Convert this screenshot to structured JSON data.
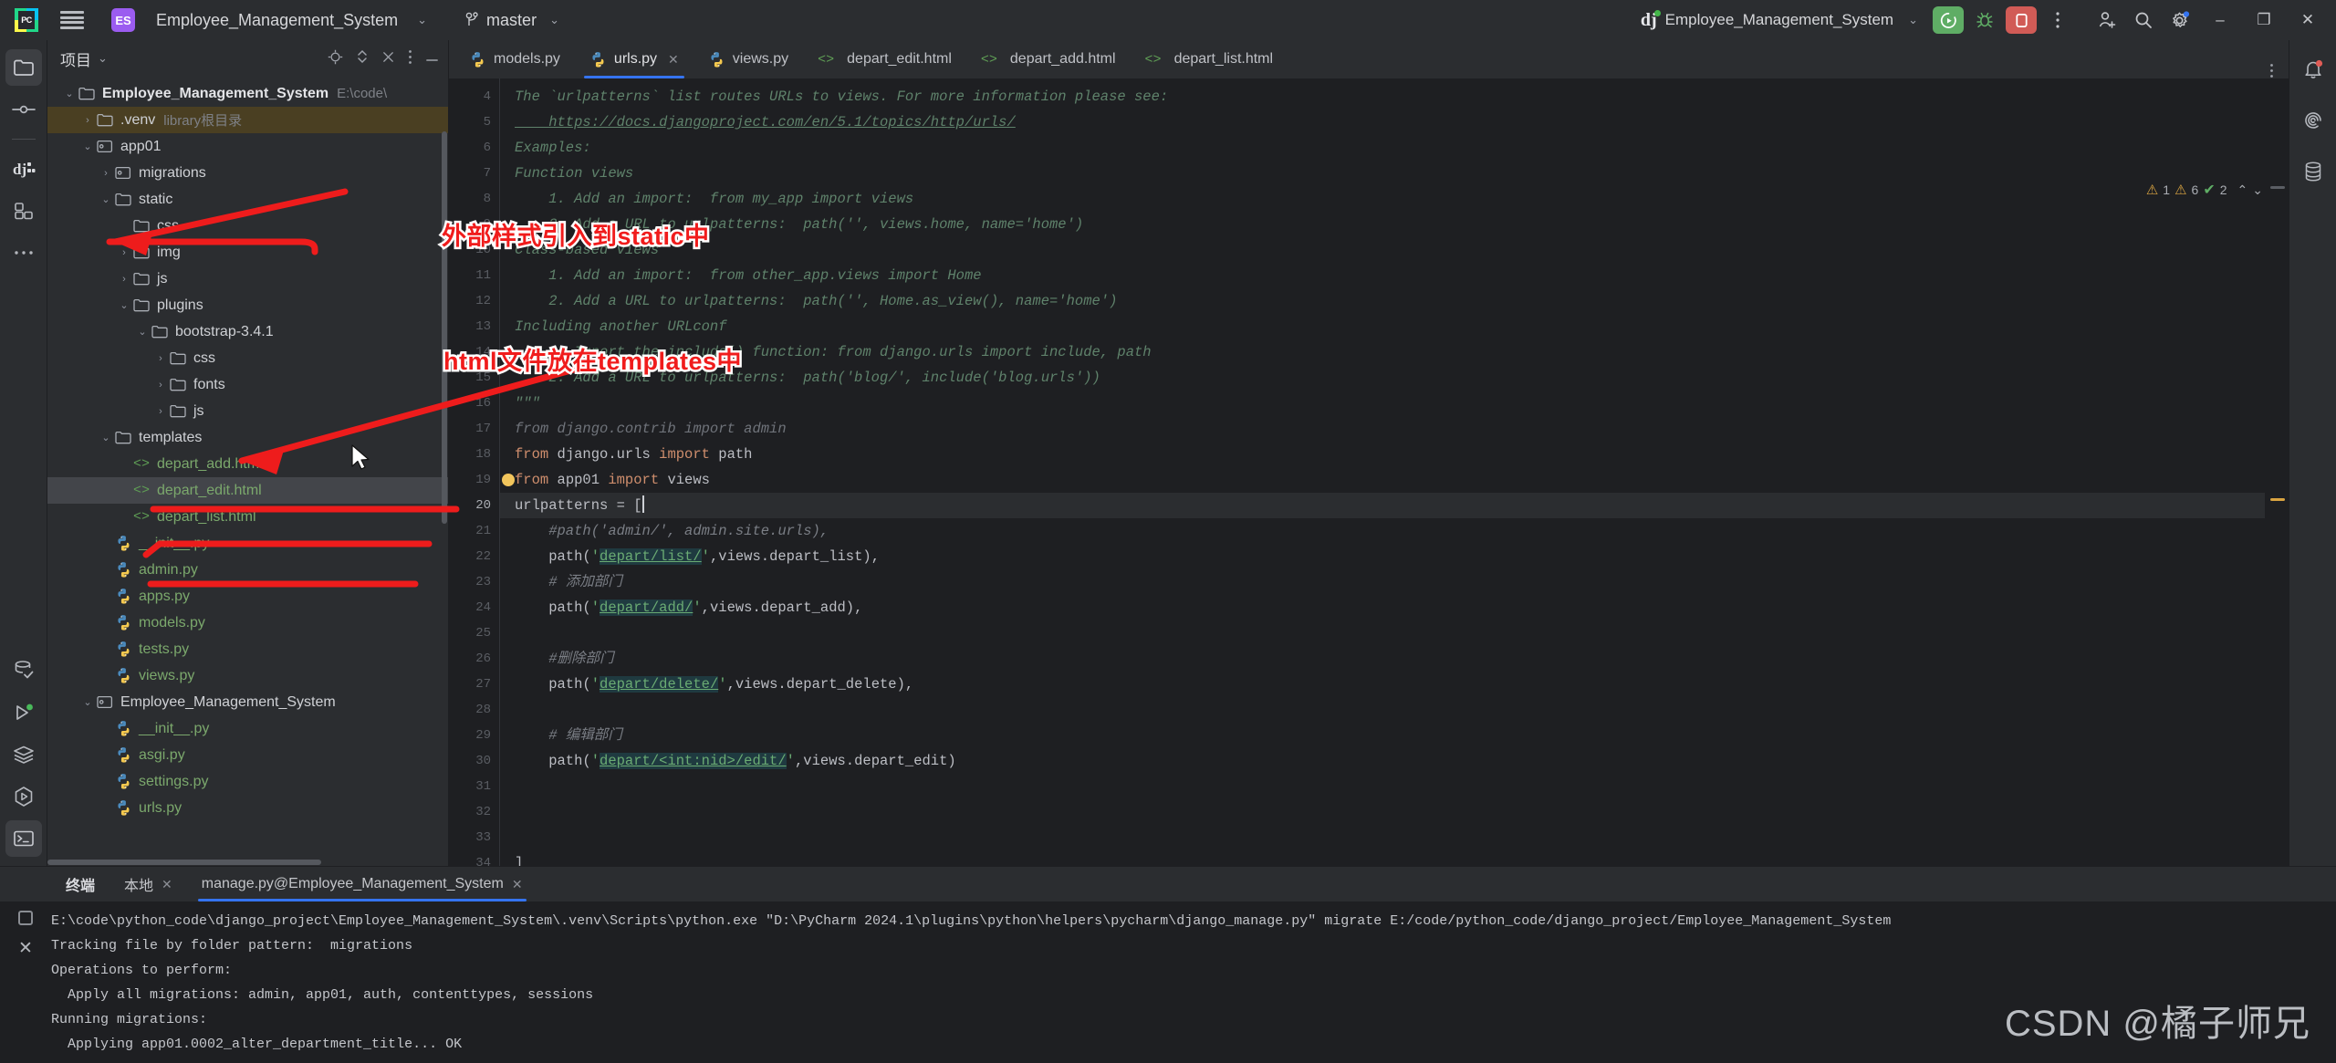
{
  "titlebar": {
    "menu_icon": "hamburger-icon",
    "project_badge": "ES",
    "project_name": "Employee_Management_System",
    "branch": "master",
    "run_config": "Employee_Management_System",
    "more_icon": "more-vertical-icon",
    "buttons": {
      "run": "run-icon",
      "debug": "debug-icon",
      "stop": "stop-icon",
      "account": "add-user-icon",
      "search": "search-icon",
      "settings": "settings-icon",
      "minimize": "–",
      "maximize": "❐",
      "close": "✕"
    }
  },
  "left_rail": {
    "items": [
      "project-icon",
      "commit-icon",
      "django-icon",
      "structure-icon",
      "more-icon"
    ],
    "bottom_items": [
      "database-check-icon",
      "run-icon",
      "services-icon",
      "plugins-icon",
      "terminal-icon"
    ]
  },
  "right_rail": {
    "items": [
      "notifications-icon",
      "ai-assistant-icon",
      "database-icon"
    ]
  },
  "project_panel": {
    "title": "项目",
    "head_icons": [
      "locate-icon",
      "expand-collapse-icon",
      "close-icon",
      "options-icon",
      "hide-icon"
    ],
    "tree": [
      {
        "depth": 0,
        "arrow": "v",
        "icon": "folder",
        "label": "Employee_Management_System",
        "sub": "E:\\code\\",
        "bold": true,
        "state": "normal"
      },
      {
        "depth": 1,
        "arrow": ">",
        "icon": "folder",
        "label": ".venv",
        "sub": "library根目录",
        "bold": false,
        "state": "venv"
      },
      {
        "depth": 1,
        "arrow": "v",
        "icon": "module",
        "label": "app01",
        "sub": "",
        "bold": false,
        "state": "normal"
      },
      {
        "depth": 2,
        "arrow": ">",
        "icon": "module",
        "label": "migrations",
        "sub": "",
        "bold": false,
        "state": "normal"
      },
      {
        "depth": 2,
        "arrow": "v",
        "icon": "folder",
        "label": "static",
        "sub": "",
        "bold": false,
        "state": "normal"
      },
      {
        "depth": 3,
        "arrow": "",
        "icon": "folder",
        "label": "css",
        "sub": "",
        "bold": false,
        "state": "normal"
      },
      {
        "depth": 3,
        "arrow": ">",
        "icon": "folder",
        "label": "img",
        "sub": "",
        "bold": false,
        "state": "normal"
      },
      {
        "depth": 3,
        "arrow": ">",
        "icon": "folder",
        "label": "js",
        "sub": "",
        "bold": false,
        "state": "normal"
      },
      {
        "depth": 3,
        "arrow": "v",
        "icon": "folder",
        "label": "plugins",
        "sub": "",
        "bold": false,
        "state": "normal"
      },
      {
        "depth": 4,
        "arrow": "v",
        "icon": "folder",
        "label": "bootstrap-3.4.1",
        "sub": "",
        "bold": false,
        "state": "normal"
      },
      {
        "depth": 5,
        "arrow": ">",
        "icon": "folder",
        "label": "css",
        "sub": "",
        "bold": false,
        "state": "normal"
      },
      {
        "depth": 5,
        "arrow": ">",
        "icon": "folder",
        "label": "fonts",
        "sub": "",
        "bold": false,
        "state": "normal"
      },
      {
        "depth": 5,
        "arrow": ">",
        "icon": "folder",
        "label": "js",
        "sub": "",
        "bold": false,
        "state": "normal"
      },
      {
        "depth": 2,
        "arrow": "v",
        "icon": "folder",
        "label": "templates",
        "sub": "",
        "bold": false,
        "state": "normal"
      },
      {
        "depth": 3,
        "arrow": "",
        "icon": "html",
        "label": "depart_add.html",
        "sub": "",
        "bold": false,
        "state": "normal"
      },
      {
        "depth": 3,
        "arrow": "",
        "icon": "html",
        "label": "depart_edit.html",
        "sub": "",
        "bold": false,
        "state": "selected"
      },
      {
        "depth": 3,
        "arrow": "",
        "icon": "html",
        "label": "depart_list.html",
        "sub": "",
        "bold": false,
        "state": "normal"
      },
      {
        "depth": 2,
        "arrow": "",
        "icon": "py",
        "label": "__init__.py",
        "sub": "",
        "bold": false,
        "state": "normal"
      },
      {
        "depth": 2,
        "arrow": "",
        "icon": "py",
        "label": "admin.py",
        "sub": "",
        "bold": false,
        "state": "normal"
      },
      {
        "depth": 2,
        "arrow": "",
        "icon": "py",
        "label": "apps.py",
        "sub": "",
        "bold": false,
        "state": "normal"
      },
      {
        "depth": 2,
        "arrow": "",
        "icon": "py",
        "label": "models.py",
        "sub": "",
        "bold": false,
        "state": "normal"
      },
      {
        "depth": 2,
        "arrow": "",
        "icon": "py",
        "label": "tests.py",
        "sub": "",
        "bold": false,
        "state": "normal"
      },
      {
        "depth": 2,
        "arrow": "",
        "icon": "py",
        "label": "views.py",
        "sub": "",
        "bold": false,
        "state": "normal"
      },
      {
        "depth": 1,
        "arrow": "v",
        "icon": "module",
        "label": "Employee_Management_System",
        "sub": "",
        "bold": false,
        "state": "normal"
      },
      {
        "depth": 2,
        "arrow": "",
        "icon": "py",
        "label": "__init__.py",
        "sub": "",
        "bold": false,
        "state": "normal"
      },
      {
        "depth": 2,
        "arrow": "",
        "icon": "py",
        "label": "asgi.py",
        "sub": "",
        "bold": false,
        "state": "normal"
      },
      {
        "depth": 2,
        "arrow": "",
        "icon": "py",
        "label": "settings.py",
        "sub": "",
        "bold": false,
        "state": "normal"
      },
      {
        "depth": 2,
        "arrow": "",
        "icon": "py",
        "label": "urls.py",
        "sub": "",
        "bold": false,
        "state": "normal"
      }
    ]
  },
  "editor": {
    "tabs": [
      {
        "label": "models.py",
        "icon": "python-icon",
        "active": false,
        "closable": false
      },
      {
        "label": "urls.py",
        "icon": "python-icon",
        "active": true,
        "closable": true
      },
      {
        "label": "views.py",
        "icon": "python-icon",
        "active": false,
        "closable": false
      },
      {
        "label": "depart_edit.html",
        "icon": "html-icon",
        "active": false,
        "closable": false
      },
      {
        "label": "depart_add.html",
        "icon": "html-icon",
        "active": false,
        "closable": false
      },
      {
        "label": "depart_list.html",
        "icon": "html-icon",
        "active": false,
        "closable": false
      }
    ],
    "inspection": {
      "warnings": "1",
      "weak_warnings": "6",
      "typos": "2",
      "up": "⌃",
      "down": "⌄"
    },
    "first_line_number": 4,
    "lines": [
      {
        "n": 4,
        "segs": [
          {
            "t": "The `urlpatterns` list routes URLs to views. For more information please see:",
            "c": "doc",
            "indent": 0
          }
        ]
      },
      {
        "n": 5,
        "segs": [
          {
            "t": "https://docs.djangoproject.com/en/5.1/topics/http/urls/",
            "c": "lnk",
            "indent": 4
          }
        ]
      },
      {
        "n": 6,
        "segs": [
          {
            "t": "Examples:",
            "c": "doc",
            "indent": 0
          }
        ]
      },
      {
        "n": 7,
        "segs": [
          {
            "t": "Function views",
            "c": "doc",
            "indent": 0
          }
        ]
      },
      {
        "n": 8,
        "segs": [
          {
            "t": "1. Add an import:  from my_app import views",
            "c": "doc",
            "indent": 4
          }
        ]
      },
      {
        "n": 9,
        "segs": [
          {
            "t": "2. Add a URL to urlpatterns:  path('', views.home, name='home')",
            "c": "doc",
            "indent": 4
          }
        ]
      },
      {
        "n": 10,
        "segs": [
          {
            "t": "Class-based views",
            "c": "doc",
            "indent": 0
          }
        ]
      },
      {
        "n": 11,
        "segs": [
          {
            "t": "1. Add an import:  from other_app.views import Home",
            "c": "doc",
            "indent": 4
          }
        ]
      },
      {
        "n": 12,
        "segs": [
          {
            "t": "2. Add a URL to urlpatterns:  path('', Home.as_view(), name='home')",
            "c": "doc",
            "indent": 4
          }
        ]
      },
      {
        "n": 13,
        "segs": [
          {
            "t": "Including another URLconf",
            "c": "doc",
            "indent": 0
          }
        ]
      },
      {
        "n": 14,
        "segs": [
          {
            "t": "1. Import the include() function: from django.urls import include, path",
            "c": "doc",
            "indent": 4
          }
        ]
      },
      {
        "n": 15,
        "segs": [
          {
            "t": "2. Add a URL to urlpatterns:  path('blog/', include('blog.urls'))",
            "c": "doc",
            "indent": 4
          }
        ]
      },
      {
        "n": 16,
        "segs": [
          {
            "t": "\"\"\"",
            "c": "doc",
            "indent": 0
          }
        ]
      },
      {
        "n": 17,
        "segs": [
          {
            "t": "from django.contrib import admin",
            "c": "gray",
            "indent": 0
          }
        ]
      },
      {
        "n": 18,
        "segs": [
          {
            "t": "from ",
            "c": "kw",
            "indent": 0
          },
          {
            "t": "django.urls ",
            "c": "id"
          },
          {
            "t": "import ",
            "c": "kw"
          },
          {
            "t": "path",
            "c": "id"
          }
        ]
      },
      {
        "n": 19,
        "segs": [
          {
            "t": "from ",
            "c": "kw",
            "indent": 0
          },
          {
            "t": "app01 ",
            "c": "id"
          },
          {
            "t": "import ",
            "c": "kw"
          },
          {
            "t": "views",
            "c": "id"
          }
        ]
      },
      {
        "n": 20,
        "segs": [
          {
            "t": "urlpatterns = [",
            "c": "id",
            "indent": 0
          }
        ],
        "current": true,
        "cursor": true
      },
      {
        "n": 21,
        "segs": [
          {
            "t": "#path('admin/', admin.site.urls),",
            "c": "cmt",
            "indent": 4
          }
        ]
      },
      {
        "n": 22,
        "segs": [
          {
            "t": "path(",
            "c": "fn",
            "indent": 4
          },
          {
            "t": "'",
            "c": "str"
          },
          {
            "t": "depart/list/",
            "c": "strlnk"
          },
          {
            "t": "'",
            "c": "str"
          },
          {
            "t": ",views.depart_list),",
            "c": "fn"
          }
        ]
      },
      {
        "n": 23,
        "segs": [
          {
            "t": "# 添加部门",
            "c": "cmt",
            "indent": 4
          }
        ]
      },
      {
        "n": 24,
        "segs": [
          {
            "t": "path(",
            "c": "fn",
            "indent": 4
          },
          {
            "t": "'",
            "c": "str"
          },
          {
            "t": "depart/add/",
            "c": "strlnk"
          },
          {
            "t": "'",
            "c": "str"
          },
          {
            "t": ",views.depart_add),",
            "c": "fn"
          }
        ]
      },
      {
        "n": 25,
        "segs": []
      },
      {
        "n": 26,
        "segs": [
          {
            "t": "#删除部门",
            "c": "cmt",
            "indent": 4
          }
        ]
      },
      {
        "n": 27,
        "segs": [
          {
            "t": "path(",
            "c": "fn",
            "indent": 4
          },
          {
            "t": "'",
            "c": "str"
          },
          {
            "t": "depart/delete/",
            "c": "strlnk"
          },
          {
            "t": "'",
            "c": "str"
          },
          {
            "t": ",views.depart_delete),",
            "c": "fn"
          }
        ]
      },
      {
        "n": 28,
        "segs": []
      },
      {
        "n": 29,
        "segs": [
          {
            "t": "# 编辑部门",
            "c": "cmt",
            "indent": 4
          }
        ]
      },
      {
        "n": 30,
        "segs": [
          {
            "t": "path(",
            "c": "fn",
            "indent": 4
          },
          {
            "t": "'",
            "c": "str"
          },
          {
            "t": "depart/<int:nid>/edit/",
            "c": "strlnk"
          },
          {
            "t": "'",
            "c": "str"
          },
          {
            "t": ",views.depart_edit)",
            "c": "fn"
          }
        ]
      },
      {
        "n": 31,
        "segs": []
      },
      {
        "n": 32,
        "segs": []
      },
      {
        "n": 33,
        "segs": []
      },
      {
        "n": 34,
        "segs": [
          {
            "t": "]",
            "c": "id",
            "indent": 0
          }
        ]
      }
    ]
  },
  "terminal": {
    "tabs": [
      {
        "label": "终端",
        "closable": false,
        "bold": true,
        "active": false
      },
      {
        "label": "本地",
        "closable": true,
        "bold": false,
        "active": false
      },
      {
        "label": "manage.py@Employee_Management_System",
        "closable": true,
        "bold": false,
        "active": true
      }
    ],
    "rail_icons": [
      "rerun-icon",
      "close-icon"
    ],
    "output": [
      "E:\\code\\python_code\\django_project\\Employee_Management_System\\.venv\\Scripts\\python.exe \"D:\\PyCharm 2024.1\\plugins\\python\\helpers\\pycharm\\django_manage.py\" migrate E:/code/python_code/django_project/Employee_Management_System",
      "Tracking file by folder pattern:  migrations",
      "Operations to perform:",
      "  Apply all migrations: admin, app01, auth, contenttypes, sessions",
      "Running migrations:",
      "  Applying app01.0002_alter_department_title... OK"
    ]
  },
  "annotations": [
    {
      "id": "anno-static",
      "text": "外部样式引入到static中"
    },
    {
      "id": "anno-templates",
      "text": "html文件放在templates中"
    }
  ],
  "watermark": "CSDN @橘子师兄"
}
